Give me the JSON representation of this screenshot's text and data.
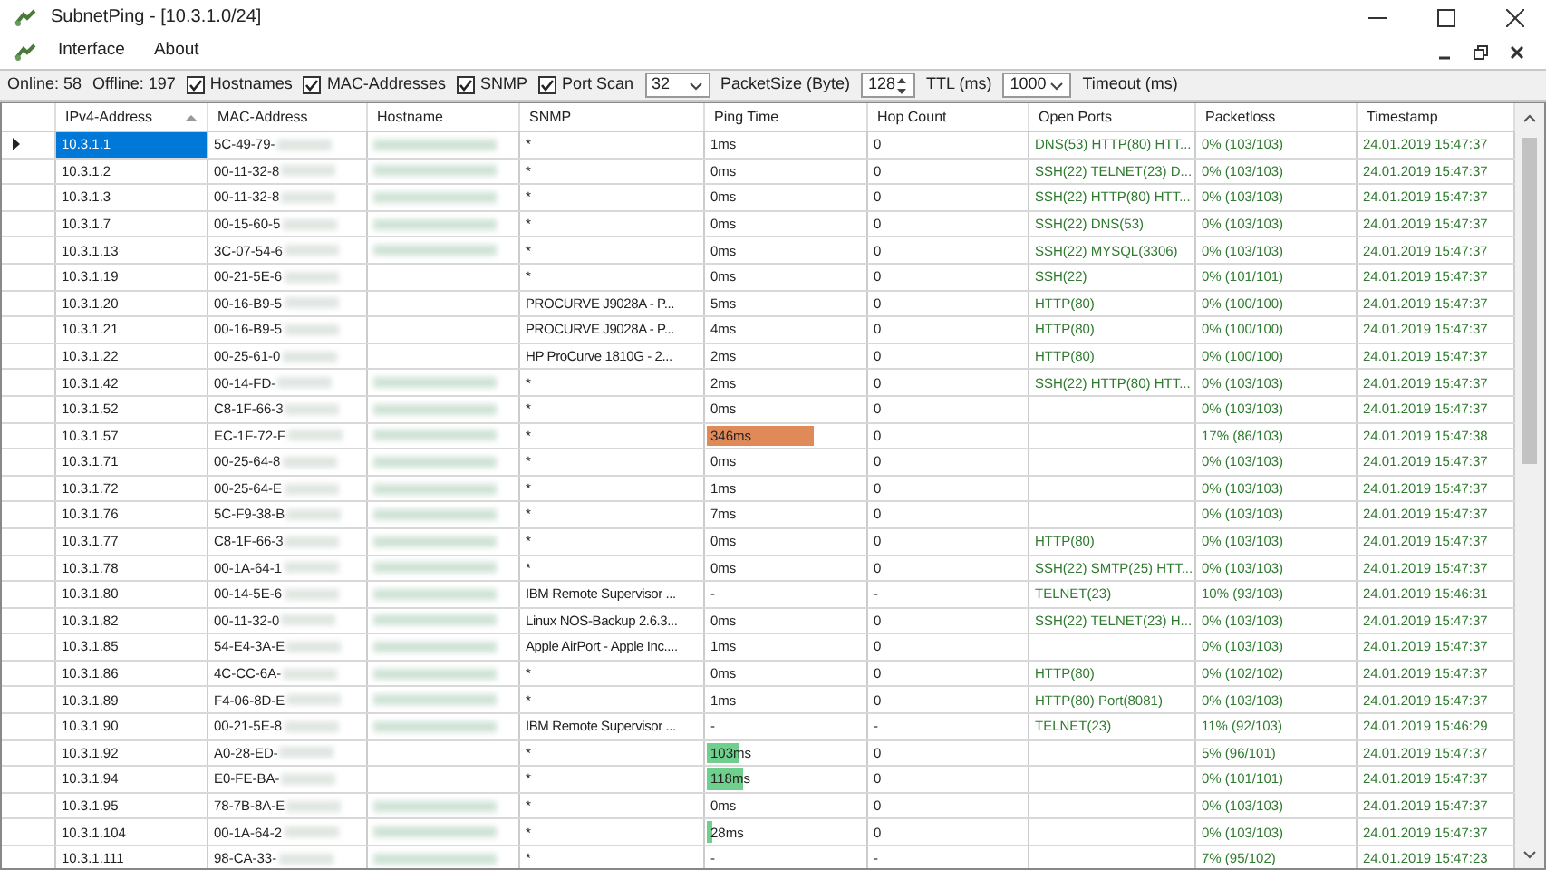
{
  "window": {
    "title": "SubnetPing - [10.3.1.0/24]"
  },
  "menu": [
    "Interface",
    "About"
  ],
  "toolbar": {
    "online": "Online: 58",
    "offline": "Offline: 197",
    "options": [
      {
        "label": "Hostnames",
        "checked": true
      },
      {
        "label": "MAC-Addresses",
        "checked": true
      },
      {
        "label": "SNMP",
        "checked": true
      },
      {
        "label": "Port Scan",
        "checked": true
      }
    ],
    "packet_size": {
      "value": "32",
      "label": "PacketSize (Byte)"
    },
    "ttl": {
      "value": "128",
      "label": "TTL (ms)"
    },
    "timeout": {
      "value": "1000",
      "label": "Timeout (ms)"
    }
  },
  "table": {
    "columns": [
      "IPv4-Address",
      "MAC-Address",
      "Hostname",
      "SNMP",
      "Ping Time",
      "Hop Count",
      "Open Ports",
      "Packetloss",
      "Timestamp"
    ],
    "rows": [
      {
        "selected": true,
        "ip": "10.3.1.1",
        "mac": "5C-49-79-",
        "hostname_blurred": true,
        "snmp": "*",
        "ping": "1ms",
        "hops": "0",
        "ports": "DNS(53) HTTP(80) HTT...",
        "loss": "0% (103/103)",
        "time": "24.01.2019 15:47:37"
      },
      {
        "selected": false,
        "ip": "10.3.1.2",
        "mac": "00-11-32-8",
        "hostname_blurred": true,
        "snmp": "*",
        "ping": "0ms",
        "hops": "0",
        "ports": "SSH(22) TELNET(23) D...",
        "loss": "0% (103/103)",
        "time": "24.01.2019 15:47:37"
      },
      {
        "selected": false,
        "ip": "10.3.1.3",
        "mac": "00-11-32-8",
        "hostname_blurred": true,
        "snmp": "*",
        "ping": "0ms",
        "hops": "0",
        "ports": "SSH(22) HTTP(80) HTT...",
        "loss": "0% (103/103)",
        "time": "24.01.2019 15:47:37"
      },
      {
        "selected": false,
        "ip": "10.3.1.7",
        "mac": "00-15-60-5",
        "hostname_blurred": true,
        "snmp": "*",
        "ping": "0ms",
        "hops": "0",
        "ports": "SSH(22) DNS(53)",
        "loss": "0% (103/103)",
        "time": "24.01.2019 15:47:37"
      },
      {
        "selected": false,
        "ip": "10.3.1.13",
        "mac": "3C-07-54-6",
        "hostname_blurred": true,
        "snmp": "*",
        "ping": "0ms",
        "hops": "0",
        "ports": "SSH(22) MYSQL(3306)",
        "loss": "0% (103/103)",
        "time": "24.01.2019 15:47:37"
      },
      {
        "selected": false,
        "ip": "10.3.1.19",
        "mac": "00-21-5E-6",
        "hostname_blurred": false,
        "snmp": "*",
        "ping": "0ms",
        "hops": "0",
        "ports": "SSH(22)",
        "loss": "0% (101/101)",
        "time": "24.01.2019 15:47:37"
      },
      {
        "selected": false,
        "ip": "10.3.1.20",
        "mac": "00-16-B9-5",
        "hostname_blurred": false,
        "snmp": "PROCURVE J9028A - P...",
        "ping": "5ms",
        "hops": "0",
        "ports": "HTTP(80)",
        "loss": "0% (100/100)",
        "time": "24.01.2019 15:47:37"
      },
      {
        "selected": false,
        "ip": "10.3.1.21",
        "mac": "00-16-B9-5",
        "hostname_blurred": false,
        "snmp": "PROCURVE J9028A - P...",
        "ping": "4ms",
        "hops": "0",
        "ports": "HTTP(80)",
        "loss": "0% (100/100)",
        "time": "24.01.2019 15:47:37"
      },
      {
        "selected": false,
        "ip": "10.3.1.22",
        "mac": "00-25-61-0",
        "hostname_blurred": false,
        "snmp": "HP ProCurve 1810G - 2...",
        "ping": "2ms",
        "hops": "0",
        "ports": "HTTP(80)",
        "loss": "0% (100/100)",
        "time": "24.01.2019 15:47:37"
      },
      {
        "selected": false,
        "ip": "10.3.1.42",
        "mac": "00-14-FD-",
        "hostname_blurred": true,
        "snmp": "*",
        "ping": "2ms",
        "hops": "0",
        "ports": "SSH(22) HTTP(80) HTT...",
        "loss": "0% (103/103)",
        "time": "24.01.2019 15:47:37"
      },
      {
        "selected": false,
        "ip": "10.3.1.52",
        "mac": "C8-1F-66-3",
        "hostname_blurred": true,
        "snmp": "*",
        "ping": "0ms",
        "hops": "0",
        "ports": "",
        "loss": "0% (103/103)",
        "time": "24.01.2019 15:47:37"
      },
      {
        "selected": false,
        "ip": "10.3.1.57",
        "mac": "EC-1F-72-F",
        "hostname_blurred": true,
        "snmp": "*",
        "ping": "346ms",
        "ping_bar": {
          "level": 0.66,
          "color": "#e08a5a"
        },
        "hops": "0",
        "ports": "",
        "loss": "17% (86/103)",
        "time": "24.01.2019 15:47:38"
      },
      {
        "selected": false,
        "ip": "10.3.1.71",
        "mac": "00-25-64-8",
        "hostname_blurred": true,
        "snmp": "*",
        "ping": "0ms",
        "hops": "0",
        "ports": "",
        "loss": "0% (103/103)",
        "time": "24.01.2019 15:47:37"
      },
      {
        "selected": false,
        "ip": "10.3.1.72",
        "mac": "00-25-64-E",
        "hostname_blurred": true,
        "snmp": "*",
        "ping": "1ms",
        "hops": "0",
        "ports": "",
        "loss": "0% (103/103)",
        "time": "24.01.2019 15:47:37"
      },
      {
        "selected": false,
        "ip": "10.3.1.76",
        "mac": "5C-F9-38-B",
        "hostname_blurred": true,
        "snmp": "*",
        "ping": "7ms",
        "hops": "0",
        "ports": "",
        "loss": "0% (103/103)",
        "time": "24.01.2019 15:47:37"
      },
      {
        "selected": false,
        "ip": "10.3.1.77",
        "mac": "C8-1F-66-3",
        "hostname_blurred": true,
        "snmp": "*",
        "ping": "0ms",
        "hops": "0",
        "ports": "HTTP(80)",
        "loss": "0% (103/103)",
        "time": "24.01.2019 15:47:37"
      },
      {
        "selected": false,
        "ip": "10.3.1.78",
        "mac": "00-1A-64-1",
        "hostname_blurred": true,
        "snmp": "*",
        "ping": "0ms",
        "hops": "0",
        "ports": "SSH(22) SMTP(25) HTT...",
        "loss": "0% (103/103)",
        "time": "24.01.2019 15:47:37"
      },
      {
        "selected": false,
        "ip": "10.3.1.80",
        "mac": "00-14-5E-6",
        "hostname_blurred": true,
        "snmp": "IBM Remote Supervisor ...",
        "ping": "-",
        "hops": "-",
        "ports": "TELNET(23)",
        "loss": "10% (93/103)",
        "time": "24.01.2019 15:46:31"
      },
      {
        "selected": false,
        "ip": "10.3.1.82",
        "mac": "00-11-32-0",
        "hostname_blurred": true,
        "snmp": "Linux NOS-Backup 2.6.3...",
        "ping": "0ms",
        "hops": "0",
        "ports": "SSH(22) TELNET(23) H...",
        "loss": "0% (103/103)",
        "time": "24.01.2019 15:47:37"
      },
      {
        "selected": false,
        "ip": "10.3.1.85",
        "mac": "54-E4-3A-E",
        "hostname_blurred": true,
        "snmp": "Apple AirPort - Apple Inc....",
        "ping": "1ms",
        "hops": "0",
        "ports": "",
        "loss": "0% (103/103)",
        "time": "24.01.2019 15:47:37"
      },
      {
        "selected": false,
        "ip": "10.3.1.86",
        "mac": "4C-CC-6A-",
        "hostname_blurred": true,
        "snmp": "*",
        "ping": "0ms",
        "hops": "0",
        "ports": "HTTP(80)",
        "loss": "0% (102/102)",
        "time": "24.01.2019 15:47:37"
      },
      {
        "selected": false,
        "ip": "10.3.1.89",
        "mac": "F4-06-8D-E",
        "hostname_blurred": true,
        "snmp": "*",
        "ping": "1ms",
        "hops": "0",
        "ports": "HTTP(80) Port(8081)",
        "loss": "0% (103/103)",
        "time": "24.01.2019 15:47:37"
      },
      {
        "selected": false,
        "ip": "10.3.1.90",
        "mac": "00-21-5E-8",
        "hostname_blurred": true,
        "snmp": "IBM Remote Supervisor ...",
        "ping": "-",
        "hops": "-",
        "ports": "TELNET(23)",
        "loss": "11% (92/103)",
        "time": "24.01.2019 15:46:29"
      },
      {
        "selected": false,
        "ip": "10.3.1.92",
        "mac": "A0-28-ED-",
        "hostname_blurred": false,
        "snmp": "*",
        "ping": "103ms",
        "ping_bar": {
          "level": 0.2,
          "color": "#6fcf8c"
        },
        "hops": "0",
        "ports": "",
        "loss": "5% (96/101)",
        "time": "24.01.2019 15:47:37"
      },
      {
        "selected": false,
        "ip": "10.3.1.94",
        "mac": "E0-FE-BA-",
        "hostname_blurred": false,
        "snmp": "*",
        "ping": "118ms",
        "ping_bar": {
          "level": 0.23,
          "color": "#6fcf8c"
        },
        "hops": "0",
        "ports": "",
        "loss": "0% (101/101)",
        "time": "24.01.2019 15:47:37"
      },
      {
        "selected": false,
        "ip": "10.3.1.95",
        "mac": "78-7B-8A-E",
        "hostname_blurred": true,
        "snmp": "*",
        "ping": "0ms",
        "hops": "0",
        "ports": "",
        "loss": "0% (103/103)",
        "time": "24.01.2019 15:47:37"
      },
      {
        "selected": false,
        "ip": "10.3.1.104",
        "mac": "00-1A-64-2",
        "hostname_blurred": true,
        "snmp": "*",
        "ping": "28ms",
        "ping_bar": {
          "level": 0.03,
          "color": "#6fcf8c"
        },
        "hops": "0",
        "ports": "",
        "loss": "0% (103/103)",
        "time": "24.01.2019 15:47:37"
      },
      {
        "selected": false,
        "ip": "10.3.1.111",
        "mac": "98-CA-33-",
        "hostname_blurred": true,
        "snmp": "*",
        "ping": "-",
        "hops": "-",
        "ports": "",
        "loss": "7% (95/102)",
        "time": "24.01.2019 15:47:23"
      }
    ]
  }
}
